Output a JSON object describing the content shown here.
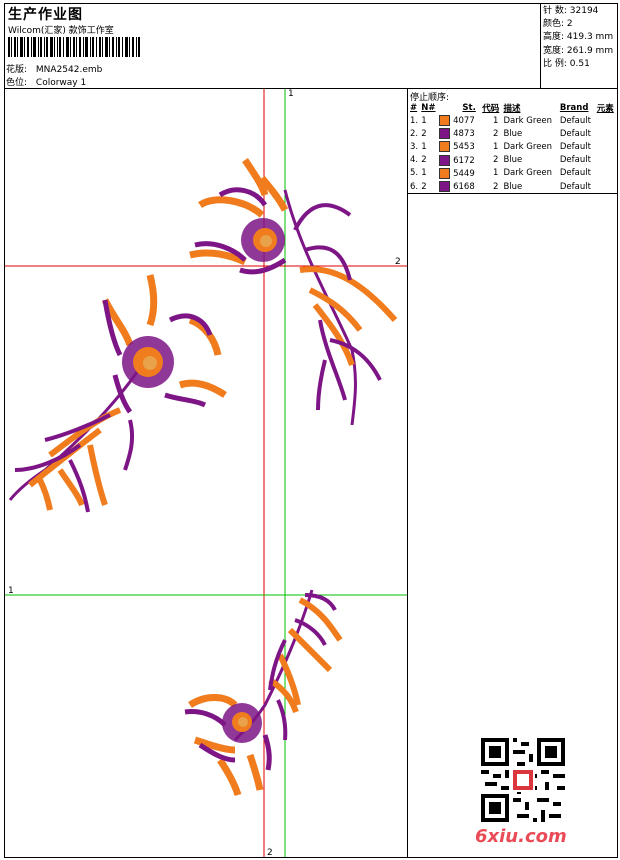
{
  "header": {
    "title": "生产作业图",
    "subtitle": "Wilcom(汇家) 款饰工作室",
    "pattern_label": "花版:",
    "pattern_value": "MNA2542.emb",
    "color_label": "色位:",
    "color_value": "Colorway 1"
  },
  "stats": [
    {
      "label": "针 数:",
      "value": "32194"
    },
    {
      "label": "颜色:",
      "value": "2"
    },
    {
      "label": "高度:",
      "value": "419.3 mm"
    },
    {
      "label": "宽度:",
      "value": "261.9 mm"
    },
    {
      "label": "比 例:",
      "value": "0.51"
    }
  ],
  "stop_sequence": {
    "title": "停止顺序:",
    "columns": [
      "#",
      "N#",
      "St.",
      "代码",
      "描述",
      "Brand",
      "元素"
    ],
    "rows": [
      {
        "num": "1.",
        "n": "1",
        "code": "4077",
        "st": "1",
        "desc": "Dark Green",
        "brand": "Default",
        "color": "#f07c1e"
      },
      {
        "num": "2.",
        "n": "2",
        "code": "4873",
        "st": "2",
        "desc": "Blue",
        "brand": "Default",
        "color": "#7d1586"
      },
      {
        "num": "3.",
        "n": "1",
        "code": "5453",
        "st": "1",
        "desc": "Dark Green",
        "brand": "Default",
        "color": "#f07c1e"
      },
      {
        "num": "4.",
        "n": "2",
        "code": "6172",
        "st": "2",
        "desc": "Blue",
        "brand": "Default",
        "color": "#7d1586"
      },
      {
        "num": "5.",
        "n": "1",
        "code": "5449",
        "st": "1",
        "desc": "Dark Green",
        "brand": "Default",
        "color": "#f07c1e"
      },
      {
        "num": "6.",
        "n": "2",
        "code": "6168",
        "st": "2",
        "desc": "Blue",
        "brand": "Default",
        "color": "#7d1586"
      }
    ]
  },
  "guides": {
    "label_1": "1",
    "label_2": "2"
  },
  "colors": {
    "orange": "#f07c1e",
    "purple": "#7d1586",
    "guide_red": "#e00000",
    "guide_green": "#00c000"
  },
  "watermark": "6xiu.com"
}
